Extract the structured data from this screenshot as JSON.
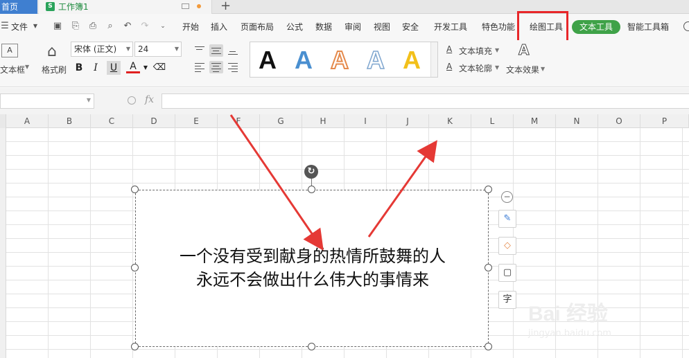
{
  "titlebar": {
    "home_tab": "首页",
    "book_tab": "工作簿1",
    "book_icon_letter": "S",
    "new_tab": "+"
  },
  "menu": {
    "file_label": "文件",
    "items": [
      "开始",
      "插入",
      "页面布局",
      "公式",
      "数据",
      "审阅",
      "视图",
      "安全",
      "开发工具",
      "特色功能",
      "绘图工具"
    ],
    "text_tools_label": "文本工具",
    "smart_toolbox_label": "智能工具箱"
  },
  "ribbon": {
    "textbox_label": "文本框",
    "format_painter_label": "格式刷",
    "font_name": "宋体 (正文)",
    "font_size": "24",
    "bold": "B",
    "italic": "I",
    "underline": "U",
    "font_color": "A",
    "art_glyph": "A",
    "text_fill_label": "文本填充",
    "text_outline_label": "文本轮廓",
    "text_effect_label": "文本效果",
    "art_colors": [
      "#111111",
      "#4a8fd0",
      "#e58a4c",
      "#ffffff",
      "#f2c01b"
    ]
  },
  "formula": {
    "fx_label": "fx"
  },
  "sheet": {
    "columns": [
      "A",
      "B",
      "C",
      "D",
      "E",
      "F",
      "G",
      "H",
      "I",
      "J",
      "K",
      "L",
      "M",
      "N",
      "O",
      "P"
    ]
  },
  "textbox": {
    "line1": "一个没有受到献身的热情所鼓舞的人",
    "line2": "永远不会做出什么伟大的事情来"
  },
  "side_tools": {
    "text_option_label": "字"
  },
  "watermark": {
    "main": "Bai 经验",
    "sub": "jingyan.baidu.com"
  },
  "accent_colors": {
    "highlight": "#e8272a",
    "arrow": "#e53935",
    "text_tools_pill": "#3fa248",
    "home_tab": "#3f7fd0"
  }
}
